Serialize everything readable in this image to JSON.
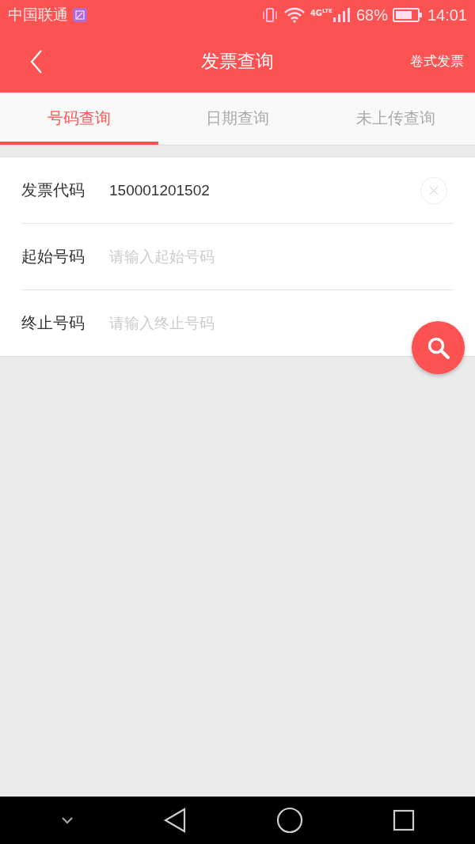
{
  "status_bar": {
    "carrier": "中国联通",
    "network": "4G",
    "network_sub": "LTE",
    "battery": "68%",
    "time": "14:01"
  },
  "header": {
    "title": "发票查询",
    "action": "卷式发票"
  },
  "tabs": [
    {
      "label": "号码查询",
      "selected": true
    },
    {
      "label": "日期查询",
      "selected": false
    },
    {
      "label": "未上传查询",
      "selected": false
    }
  ],
  "fields": [
    {
      "label": "发票代码",
      "value": "150001201502",
      "clearable": true
    },
    {
      "label": "起始号码",
      "placeholder": "请输入起始号码",
      "clearable": false
    },
    {
      "label": "终止号码",
      "placeholder": "请输入终止号码",
      "clearable": false
    }
  ]
}
